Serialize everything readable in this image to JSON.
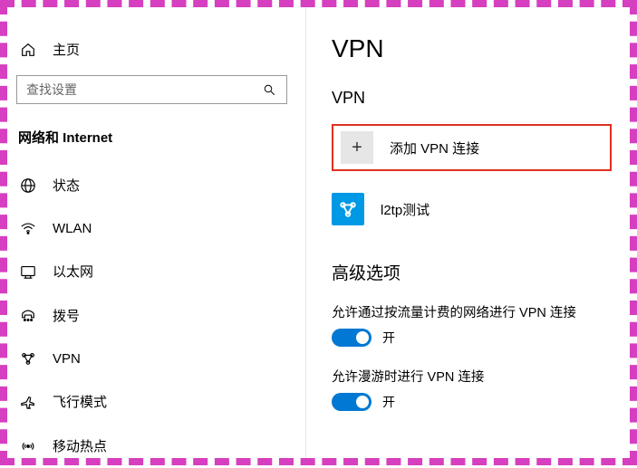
{
  "sidebar": {
    "home": "主页",
    "search_placeholder": "查找设置",
    "category": "网络和 Internet",
    "items": [
      {
        "label": "状态"
      },
      {
        "label": "WLAN"
      },
      {
        "label": "以太网"
      },
      {
        "label": "拨号"
      },
      {
        "label": "VPN"
      },
      {
        "label": "飞行模式"
      },
      {
        "label": "移动热点"
      }
    ]
  },
  "main": {
    "title": "VPN",
    "section": "VPN",
    "add_label": "添加 VPN 连接",
    "connections": [
      {
        "label": "l2tp测试"
      }
    ],
    "advanced_title": "高级选项",
    "settings": [
      {
        "label": "允许通过按流量计费的网络进行 VPN 连接",
        "state": "开"
      },
      {
        "label": "允许漫游时进行 VPN 连接",
        "state": "开"
      }
    ]
  }
}
